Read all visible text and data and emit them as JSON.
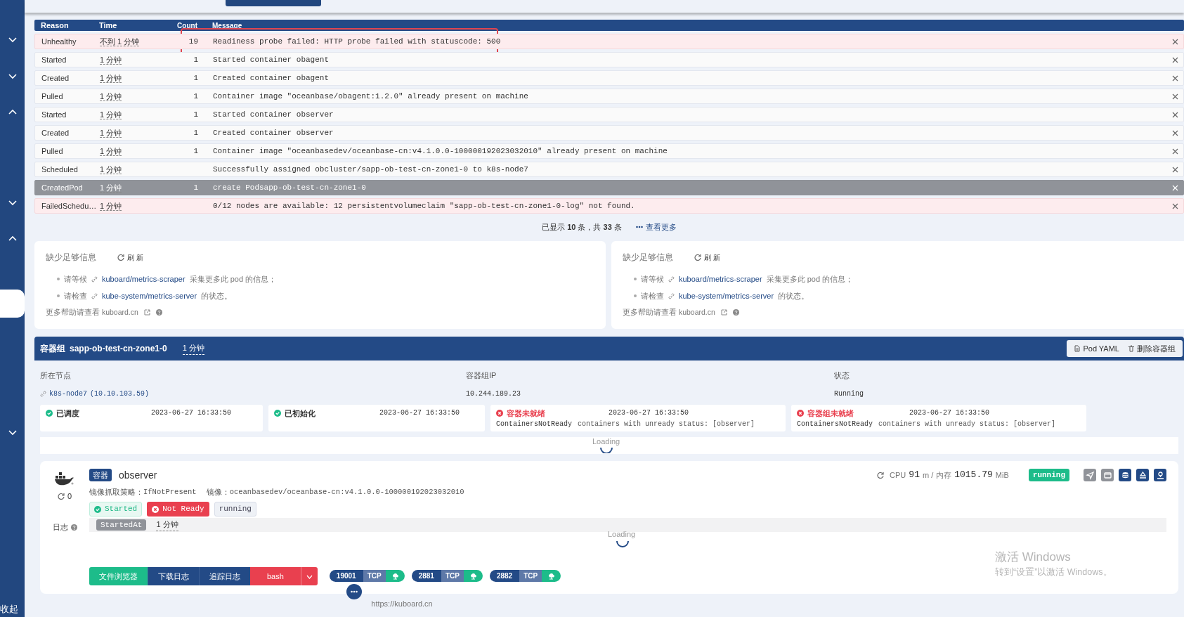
{
  "sidebar": {
    "toggles": [
      {
        "expanded": false
      },
      {
        "expanded": false
      },
      {
        "expanded": true
      },
      {
        "expanded": false
      },
      {
        "expanded": true
      },
      {
        "expanded": false
      }
    ],
    "collapse_label": "收起"
  },
  "events": {
    "columns": [
      "Reason",
      "Time",
      "Count",
      "Message"
    ],
    "rows": [
      {
        "reason": "Unhealthy",
        "time": "不到 1 分钟",
        "count": "19",
        "message": "Readiness probe failed: HTTP probe failed with statuscode: 500",
        "kind": "warning",
        "selected": false,
        "highlighted": true
      },
      {
        "reason": "Started",
        "time": "1 分钟",
        "count": "1",
        "message": "Started container obagent",
        "kind": "normal",
        "selected": false,
        "highlighted": false
      },
      {
        "reason": "Created",
        "time": "1 分钟",
        "count": "1",
        "message": "Created container obagent",
        "kind": "normal",
        "selected": false,
        "highlighted": false
      },
      {
        "reason": "Pulled",
        "time": "1 分钟",
        "count": "1",
        "message": "Container image \"oceanbase/obagent:1.2.0\" already present on machine",
        "kind": "normal",
        "selected": false,
        "highlighted": false
      },
      {
        "reason": "Started",
        "time": "1 分钟",
        "count": "1",
        "message": "Started container observer",
        "kind": "normal",
        "selected": false,
        "highlighted": false
      },
      {
        "reason": "Created",
        "time": "1 分钟",
        "count": "1",
        "message": "Created container observer",
        "kind": "normal",
        "selected": false,
        "highlighted": false
      },
      {
        "reason": "Pulled",
        "time": "1 分钟",
        "count": "1",
        "message": "Container image \"oceanbasedev/oceanbase-cn:v4.1.0.0-100000192023032010\" already present on machine",
        "kind": "normal",
        "selected": false,
        "highlighted": false
      },
      {
        "reason": "Scheduled",
        "time": "1 分钟",
        "message": "Successfully assigned obcluster/sapp-ob-test-cn-zone1-0 to k8s-node7",
        "kind": "normal",
        "selected": false,
        "highlighted": false
      },
      {
        "reason": "CreatedPod",
        "time": "1 分钟",
        "count": "1",
        "message": "create Podsapp-ob-test-cn-zone1-0",
        "selected": true,
        "highlighted": false
      },
      {
        "reason": "FailedSchedu…",
        "time": "1 分钟",
        "message": "0/12 nodes are available: 12 persistentvolumeclaim \"sapp-ob-test-cn-zone1-0-log\" not found.",
        "kind": "warning",
        "selected": false,
        "highlighted": false
      }
    ],
    "summary": "已显示 **10** 条，共 **33** 条",
    "more_link": "查看更多"
  },
  "panels": [
    {
      "title": "缺少足够信息",
      "refresh": "刷 新",
      "items": [
        {
          "prefix": "请等候",
          "link": "kuboard/metrics-scraper",
          "suffix": "采集更多此 pod 的信息；"
        },
        {
          "prefix": "请检查",
          "link": "kube-system/metrics-server",
          "suffix": "的状态。"
        }
      ],
      "help": "更多帮助请查看 kuboard.cn"
    },
    {
      "title": "缺少足够信息",
      "refresh": "刷 新",
      "items": [
        {
          "prefix": "请等候",
          "link": "kuboard/metrics-scraper",
          "suffix": "采集更多此 pod 的信息；"
        },
        {
          "prefix": "请检查",
          "link": "kube-system/metrics-server",
          "suffix": "的状态。"
        }
      ],
      "help": "更多帮助请查看 kuboard.cn"
    }
  ],
  "pod": {
    "label": "容器组",
    "name": "sapp-ob-test-cn-zone1-0",
    "age": "1 分钟",
    "buttons": [
      "Pod YAML",
      "删除容器组"
    ],
    "fields": [
      {
        "label": "所在节点",
        "value": "k8s-node7",
        "extra": "(10.10.103.59)",
        "kind": "link"
      },
      {
        "label": "容器组IP",
        "value": "10.244.189.23",
        "kind": "text"
      },
      {
        "label": "状态",
        "value": "Running",
        "kind": "text"
      }
    ],
    "conditions": [
      {
        "title": "已调度",
        "time": "2023-06-27 16:33:50",
        "ok": true
      },
      {
        "title": "已初始化",
        "time": "2023-06-27 16:33:50",
        "ok": true
      },
      {
        "title": "容器未就绪",
        "time": "2023-06-27 16:33:50",
        "ok": false,
        "reason": "ContainersNotReady",
        "message": "containers with unready status: [observer]"
      },
      {
        "title": "容器组未就绪",
        "time": "2023-06-27 16:33:50",
        "ok": false,
        "reason": "ContainersNotReady",
        "message": "containers with unready status: [observer]"
      }
    ],
    "loading": "Loading"
  },
  "container": {
    "tag": "容器",
    "name": "observer",
    "restarts": "0",
    "pull_policy_label": "镜像抓取策略：",
    "pull_policy": "IfNotPresent",
    "image_label": "镜像：",
    "image": "oceanbasedev/oceanbase-cn:v4.1.0.0-100000192023032010",
    "states": [
      {
        "label": "Started",
        "kind": "ok"
      },
      {
        "label": "Not Ready",
        "kind": "bad"
      },
      {
        "label": "running",
        "kind": "plain"
      }
    ],
    "started_at_label": "StartedAt",
    "started_at": "1 分钟",
    "log_label": "日志",
    "loading": "Loading",
    "cpu_label": "CPU",
    "cpu": "91",
    "cpu_unit": "m /",
    "mem_label": "内存",
    "mem": "1015.79",
    "mem_unit": "MiB",
    "status": "running",
    "tools": [
      {
        "kind": "send",
        "enabled": false
      },
      {
        "kind": "window",
        "enabled": false
      },
      {
        "kind": "database",
        "enabled": true
      },
      {
        "kind": "eject",
        "enabled": true
      },
      {
        "kind": "person",
        "enabled": true
      }
    ],
    "actions": [
      {
        "label": "文件浏览器",
        "kind": "green"
      },
      {
        "label": "下载日志",
        "kind": "blue"
      },
      {
        "label": "追踪日志",
        "kind": "blue"
      },
      {
        "label": "bash",
        "kind": "red"
      }
    ],
    "ports": [
      {
        "port": "19001",
        "protocol": "TCP"
      },
      {
        "port": "2881",
        "protocol": "TCP"
      },
      {
        "port": "2882",
        "protocol": "TCP"
      }
    ]
  },
  "footer": "https://kuboard.cn",
  "os_notice": {
    "title": "激活 Windows",
    "subtitle": "转到“设置”以激活 Windows。"
  }
}
